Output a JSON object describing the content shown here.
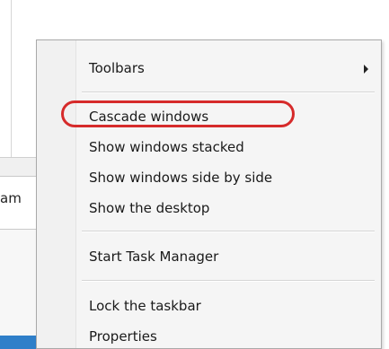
{
  "background": {
    "partial_field_text": "am"
  },
  "menu": {
    "items": [
      {
        "label": "Toolbars",
        "has_submenu": true
      },
      {
        "label": "Cascade windows",
        "highlighted": true
      },
      {
        "label": "Show windows stacked"
      },
      {
        "label": "Show windows side by side"
      },
      {
        "label": "Show the desktop"
      },
      {
        "label": "Start Task Manager"
      },
      {
        "label": "Lock the taskbar"
      },
      {
        "label": "Properties"
      }
    ]
  },
  "colors": {
    "highlight_ring": "#d62b2b",
    "taskbar_accent": "#2f7fc9"
  }
}
